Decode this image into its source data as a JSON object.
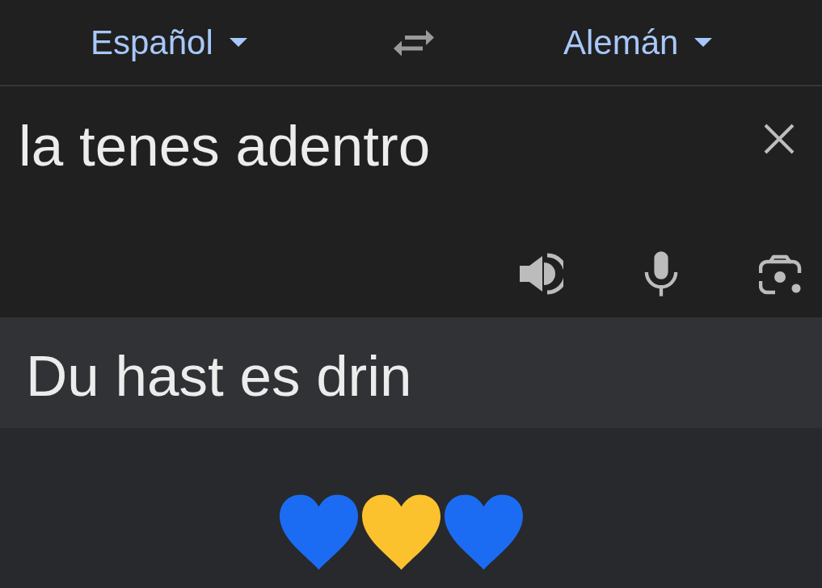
{
  "language_bar": {
    "source_language": "Español",
    "target_language": "Alemán"
  },
  "input": {
    "value": "la tenes adentro"
  },
  "translation": {
    "text": "Du hast es drin"
  },
  "hearts": [
    {
      "color": "#1b6cf2"
    },
    {
      "color": "#fbc22d"
    },
    {
      "color": "#1b6cf2"
    }
  ]
}
